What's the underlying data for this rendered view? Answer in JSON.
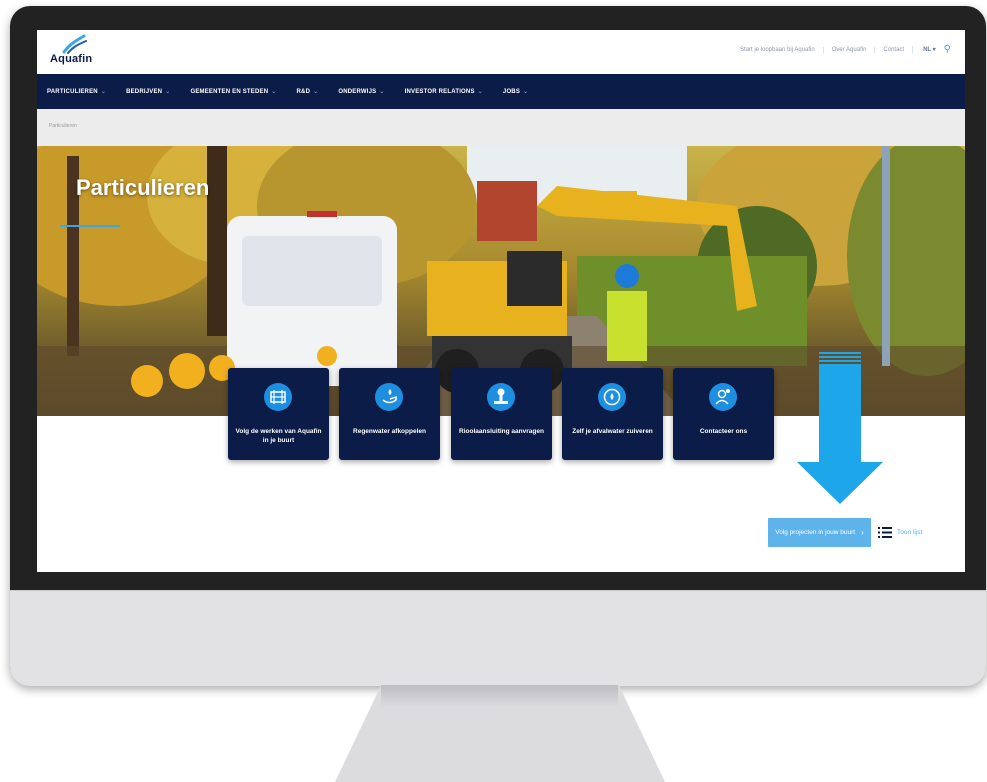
{
  "brand": {
    "name": "Aquafin"
  },
  "top_links": [
    "Start je loopbaan bij Aquafin",
    "Over Aquafin",
    "Contact"
  ],
  "language": "NL",
  "nav": {
    "items": [
      "PARTICULIEREN",
      "BEDRIJVEN",
      "GEMEENTEN EN STEDEN",
      "R&D",
      "ONDERWIJS",
      "INVESTOR RELATIONS",
      "JOBS"
    ]
  },
  "breadcrumb": "Particulieren",
  "hero": {
    "title": "Particulieren"
  },
  "tiles": [
    {
      "label": "Volg de werken van Aquafin in je buurt",
      "icon": "road-works-icon"
    },
    {
      "label": "Regenwater afkoppelen",
      "icon": "rain-hand-icon"
    },
    {
      "label": "Rioolaansluiting aanvragen",
      "icon": "sewer-connection-icon"
    },
    {
      "label": "Zelf je afvalwater zuiveren",
      "icon": "water-cycle-icon"
    },
    {
      "label": "Contacteer ons",
      "icon": "contact-person-icon"
    }
  ],
  "cta": {
    "label": "Volg projecten in jouw buurt"
  },
  "list_link": "Toon lijst",
  "colors": {
    "navy": "#0b1c49",
    "accent_blue": "#3aa6e8",
    "cta_blue": "#5db3ea",
    "arrow_blue": "#1ea6ea"
  }
}
